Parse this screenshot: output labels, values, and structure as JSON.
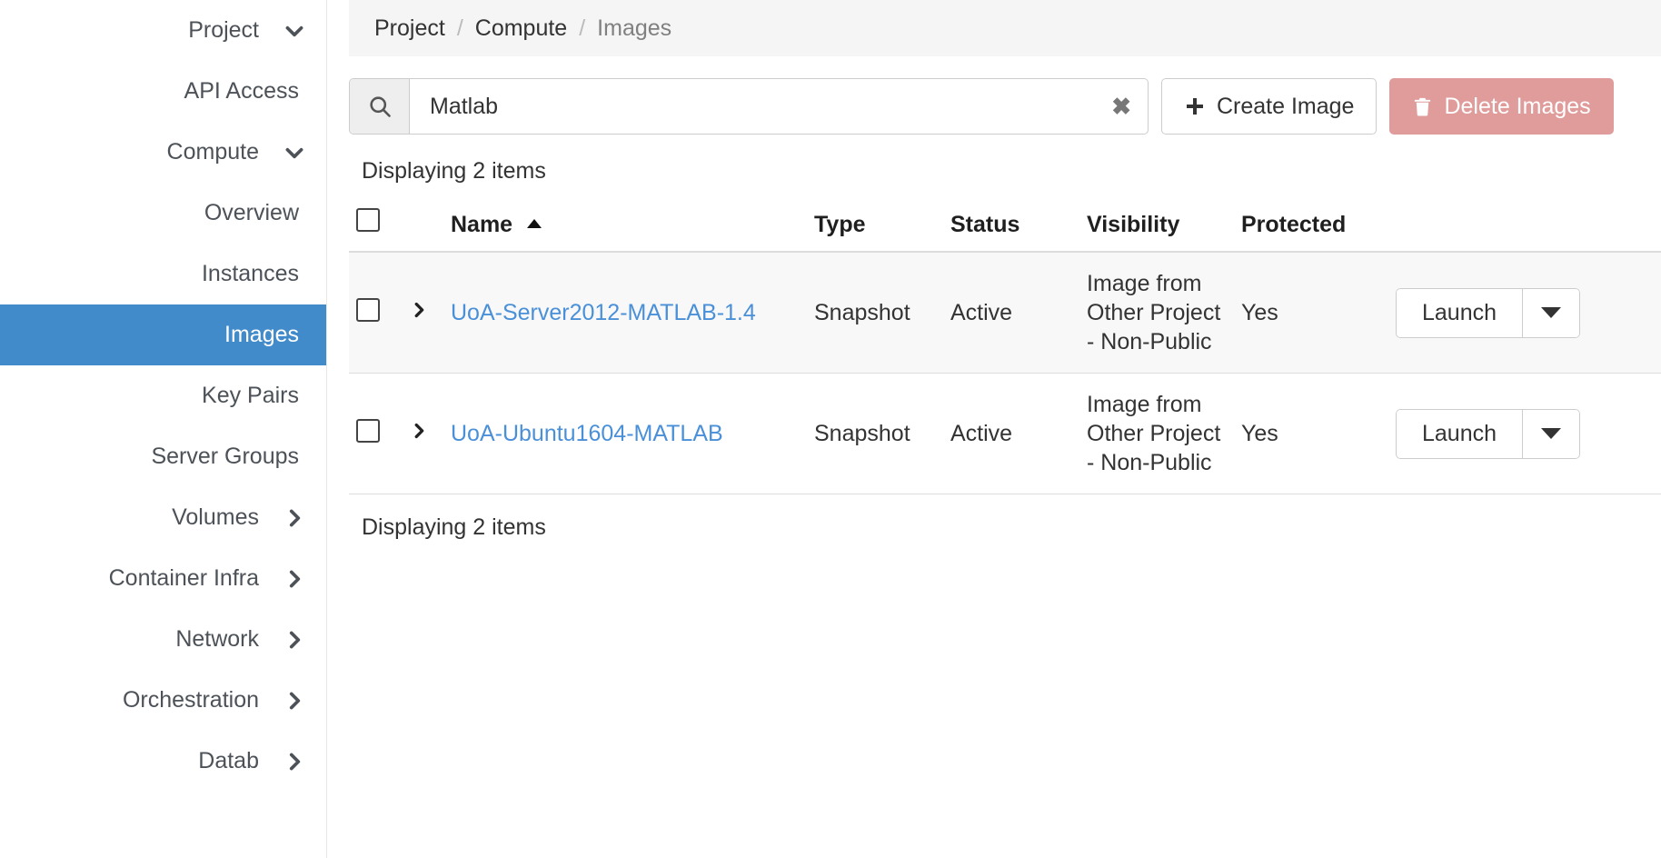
{
  "sidebar": {
    "items": [
      {
        "label": "Project",
        "level": 0,
        "icon": "chevron-down-icon",
        "active": false,
        "name": "project"
      },
      {
        "label": "API Access",
        "level": 2,
        "icon": "",
        "active": false,
        "name": "api-access"
      },
      {
        "label": "Compute",
        "level": 1,
        "icon": "chevron-down-icon",
        "active": false,
        "name": "compute"
      },
      {
        "label": "Overview",
        "level": 2,
        "icon": "",
        "active": false,
        "name": "overview"
      },
      {
        "label": "Instances",
        "level": 2,
        "icon": "",
        "active": false,
        "name": "instances"
      },
      {
        "label": "Images",
        "level": 2,
        "icon": "",
        "active": true,
        "name": "images"
      },
      {
        "label": "Key Pairs",
        "level": 2,
        "icon": "",
        "active": false,
        "name": "key-pairs"
      },
      {
        "label": "Server Groups",
        "level": 2,
        "icon": "",
        "active": false,
        "name": "server-groups"
      },
      {
        "label": "Volumes",
        "level": 1,
        "icon": "chevron-right-icon",
        "active": false,
        "name": "volumes"
      },
      {
        "label": "Container Infra",
        "level": 1,
        "icon": "chevron-right-icon",
        "active": false,
        "name": "container-infra"
      },
      {
        "label": "Network",
        "level": 1,
        "icon": "chevron-right-icon",
        "active": false,
        "name": "network"
      },
      {
        "label": "Orchestration",
        "level": 1,
        "icon": "chevron-right-icon",
        "active": false,
        "name": "orchestration"
      },
      {
        "label": "Datab",
        "level": 1,
        "icon": "chevron-right-icon",
        "active": false,
        "name": "database"
      }
    ]
  },
  "breadcrumb": {
    "project": "Project",
    "compute": "Compute",
    "images": "Images",
    "separator": "/"
  },
  "toolbar": {
    "search_value": "Matlab",
    "search_placeholder": "Filter",
    "search_icon": "search-icon",
    "clear_icon": "clear-x-icon",
    "create_label": "Create Image",
    "create_icon": "plus-icon",
    "delete_label": "Delete Images",
    "delete_icon": "trash-icon",
    "delete_color": "#e09b9b"
  },
  "table": {
    "count_top": "Displaying 2 items",
    "count_bottom": "Displaying 2 items",
    "sort_column": "Name",
    "sort_direction": "asc",
    "headers": {
      "name": "Name",
      "type": "Type",
      "status": "Status",
      "visibility": "Visibility",
      "protected": "Protected"
    },
    "rows": [
      {
        "name": "UoA-Server2012-MATLAB-1.4",
        "type": "Snapshot",
        "status": "Active",
        "visibility": "Image from Other Project - Non-Public",
        "protected": "Yes",
        "action_label": "Launch"
      },
      {
        "name": "UoA-Ubuntu1604-MATLAB",
        "type": "Snapshot",
        "status": "Active",
        "visibility": "Image from Other Project - Non-Public",
        "protected": "Yes",
        "action_label": "Launch"
      }
    ]
  },
  "colors": {
    "accent": "#428bca",
    "link": "#4a90d9",
    "danger": "#e09b9b",
    "breadcrumb_bg": "#f5f5f5"
  }
}
